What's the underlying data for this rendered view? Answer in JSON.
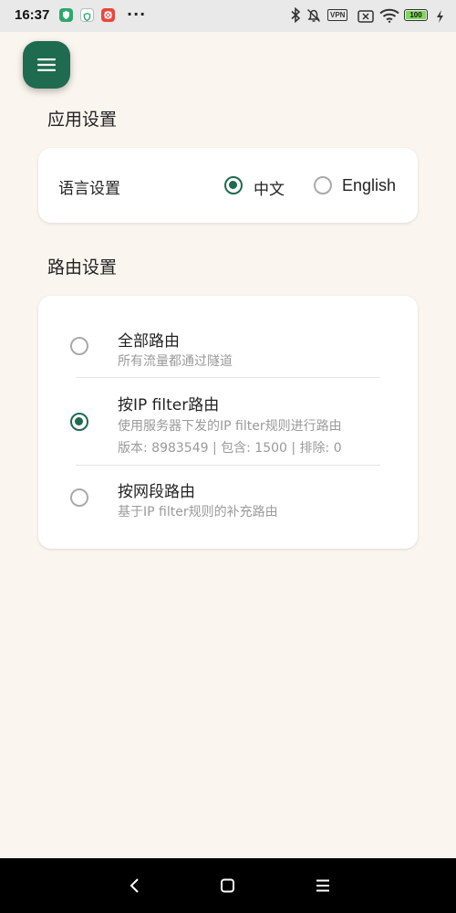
{
  "status_bar": {
    "time": "16:37",
    "more": "···",
    "vpn": "VPN",
    "battery": "100",
    "icons": [
      "shield-green-icon",
      "shield-outline-icon",
      "red-app-icon",
      "bluetooth-icon",
      "bell-off-icon",
      "vpn-icon",
      "sim-off-icon",
      "wifi-icon",
      "battery-icon",
      "charging-icon"
    ],
    "colors": {
      "battery_fill": "#7ED957",
      "app_green": "#2EA86C",
      "app_red": "#E8473E"
    }
  },
  "menu_button": {
    "icon": "menu-icon",
    "color": "#1F6B4F"
  },
  "app_settings": {
    "title": "应用设置",
    "language": {
      "label": "语言设置",
      "options": [
        {
          "label": "中文",
          "selected": true
        },
        {
          "label": "English",
          "selected": false
        }
      ]
    }
  },
  "route_settings": {
    "title": "路由设置",
    "options": [
      {
        "title": "全部路由",
        "desc": "所有流量都通过隧道",
        "selected": false
      },
      {
        "title": "按IP filter路由",
        "desc": "使用服务器下发的IP filter规则进行路由",
        "detail": "版本: 8983549 | 包含: 1500 | 排除: 0",
        "selected": true
      },
      {
        "title": "按网段路由",
        "desc": "基于IP filter规则的补充路由",
        "selected": false
      }
    ]
  },
  "nav_bar": {
    "buttons": [
      "back-icon",
      "home-icon",
      "recents-icon"
    ]
  },
  "theme": {
    "accent": "#1F6B4F",
    "background": "#FBF5EF",
    "card": "#FFFFFF"
  }
}
